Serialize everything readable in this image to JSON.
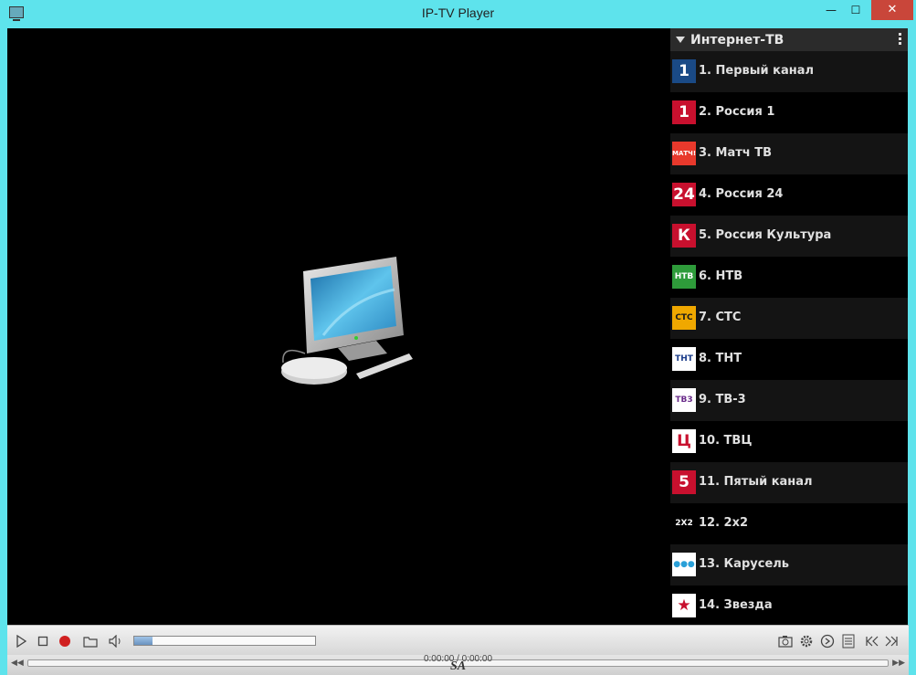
{
  "window": {
    "title": "IP-TV Player",
    "min_glyph": "—",
    "max_glyph": "☐",
    "close_glyph": "✕"
  },
  "panel": {
    "title": "Интернет-ТВ"
  },
  "channels": [
    {
      "label": "1. Первый канал",
      "logo_text": "1",
      "logo_bg": "#1a4a86",
      "logo_fg": "#ffffff"
    },
    {
      "label": "2. Россия 1",
      "logo_text": "1",
      "logo_bg": "#c8102e",
      "logo_fg": "#ffffff"
    },
    {
      "label": "3. Матч ТВ",
      "logo_text": "МАТЧ!",
      "logo_bg": "#e8392c",
      "logo_fg": "#ffffff"
    },
    {
      "label": "4. Россия 24",
      "logo_text": "24",
      "logo_bg": "#c8102e",
      "logo_fg": "#ffffff"
    },
    {
      "label": "5. Россия Культура",
      "logo_text": "К",
      "logo_bg": "#c8102e",
      "logo_fg": "#ffffff"
    },
    {
      "label": "6. НТВ",
      "logo_text": "НТВ",
      "logo_bg": "#2e9b3a",
      "logo_fg": "#ffffff"
    },
    {
      "label": "7. СТС",
      "logo_text": "СТС",
      "logo_bg": "#f0a800",
      "logo_fg": "#1a1a1a"
    },
    {
      "label": "8. ТНТ",
      "logo_text": "ТНТ",
      "logo_bg": "#ffffff",
      "logo_fg": "#1a3c8a"
    },
    {
      "label": "9. ТВ-3",
      "logo_text": "ТВ3",
      "logo_bg": "#ffffff",
      "logo_fg": "#6a2c8a"
    },
    {
      "label": "10. ТВЦ",
      "logo_text": "Ц",
      "logo_bg": "#ffffff",
      "logo_fg": "#c8102e"
    },
    {
      "label": "11. Пятый канал",
      "logo_text": "5",
      "logo_bg": "#c8102e",
      "logo_fg": "#ffffff"
    },
    {
      "label": "12. 2x2",
      "logo_text": "2X2",
      "logo_bg": "#000000",
      "logo_fg": "#ffffff"
    },
    {
      "label": "13. Карусель",
      "logo_text": "●●●",
      "logo_bg": "#ffffff",
      "logo_fg": "#2aa0d8"
    },
    {
      "label": "14. Звезда",
      "logo_text": "★",
      "logo_bg": "#ffffff",
      "logo_fg": "#c8102e"
    }
  ],
  "controls": {
    "play": "play-icon",
    "stop": "stop-icon",
    "record": "record-icon",
    "open": "folder-icon",
    "volume": "speaker-icon",
    "volume_level": 0.1,
    "snapshot": "camera-icon",
    "settings": "gear-icon",
    "scheduler": "clock-icon",
    "playlist": "list-icon",
    "prev": "prev-icon",
    "next": "next-icon"
  },
  "seek": {
    "time": "0:00:00 / 0:00:00",
    "watermark": "SA"
  }
}
